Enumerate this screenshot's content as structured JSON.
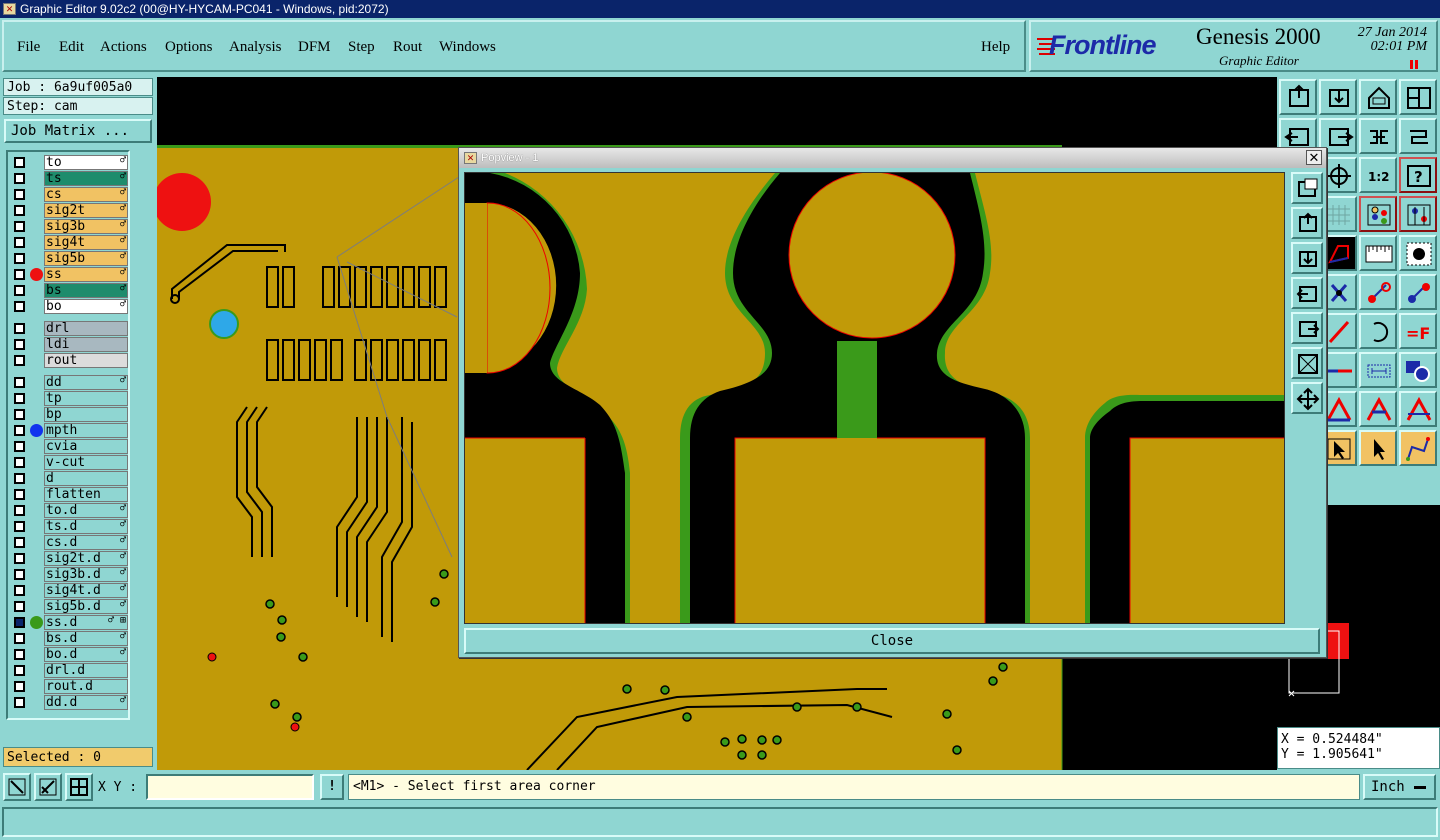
{
  "window": {
    "title": "Graphic Editor 9.02c2 (00@HY-HYCAM-PC041 - Windows, pid:2072)"
  },
  "menu": {
    "file": "File",
    "edit": "Edit",
    "actions": "Actions",
    "options": "Options",
    "analysis": "Analysis",
    "dfm": "DFM",
    "step": "Step",
    "rout": "Rout",
    "windows": "Windows",
    "help": "Help"
  },
  "brand": {
    "logo": "Frontline",
    "product": "Genesis 2000",
    "subtitle": "Graphic Editor",
    "date": "27 Jan 2014",
    "time": "02:01 PM"
  },
  "job": {
    "job_label": "Job : 6a9uf005a0",
    "step_label": "Step: cam",
    "matrix_button": "Job Matrix ..."
  },
  "layers": [
    {
      "name": "to",
      "color": "#ffffff",
      "mark": "♂"
    },
    {
      "name": "ts",
      "color": "#1e8c6c",
      "mark": "♂"
    },
    {
      "name": "cs",
      "color": "#f1c263",
      "mark": "♂"
    },
    {
      "name": "sig2t",
      "color": "#f1c263",
      "mark": "♂"
    },
    {
      "name": "sig3b",
      "color": "#f1c263",
      "mark": "♂"
    },
    {
      "name": "sig4t",
      "color": "#f1c263",
      "mark": "♂"
    },
    {
      "name": "sig5b",
      "color": "#f1c263",
      "mark": "♂"
    },
    {
      "name": "ss",
      "color": "#f1c263",
      "mark": "♂",
      "dot": "#ee1111"
    },
    {
      "name": "bs",
      "color": "#1e8c6c",
      "mark": "♂"
    },
    {
      "name": "bo",
      "color": "#ffffff",
      "mark": "♂"
    },
    {
      "name": "drl",
      "color": "#a8b8c0",
      "mark": ""
    },
    {
      "name": "ldi",
      "color": "#a8b8c0",
      "mark": ""
    },
    {
      "name": "rout",
      "color": "#dcdcdc",
      "mark": ""
    },
    {
      "name": "dd",
      "color": "#8fd6d2",
      "mark": "♂"
    },
    {
      "name": "tp",
      "color": "#8fd6d2",
      "mark": ""
    },
    {
      "name": "bp",
      "color": "#8fd6d2",
      "mark": ""
    },
    {
      "name": "mpth",
      "color": "#8fd6d2",
      "mark": "",
      "dot": "#1133ee"
    },
    {
      "name": "cvia",
      "color": "#8fd6d2",
      "mark": ""
    },
    {
      "name": "v-cut",
      "color": "#8fd6d2",
      "mark": ""
    },
    {
      "name": "d",
      "color": "#8fd6d2",
      "mark": ""
    },
    {
      "name": "flatten",
      "color": "#8fd6d2",
      "mark": ""
    },
    {
      "name": "to.d",
      "color": "#8fd6d2",
      "mark": "♂"
    },
    {
      "name": "ts.d",
      "color": "#8fd6d2",
      "mark": "♂"
    },
    {
      "name": "cs.d",
      "color": "#8fd6d2",
      "mark": "♂"
    },
    {
      "name": "sig2t.d",
      "color": "#8fd6d2",
      "mark": "♂"
    },
    {
      "name": "sig3b.d",
      "color": "#8fd6d2",
      "mark": "♂"
    },
    {
      "name": "sig4t.d",
      "color": "#8fd6d2",
      "mark": "♂"
    },
    {
      "name": "sig5b.d",
      "color": "#8fd6d2",
      "mark": "♂"
    },
    {
      "name": "ss.d",
      "color": "#8fd6d2",
      "mark": "♂ ⊞",
      "dot": "#3a9a1a",
      "work": true
    },
    {
      "name": "bs.d",
      "color": "#8fd6d2",
      "mark": "♂"
    },
    {
      "name": "bo.d",
      "color": "#8fd6d2",
      "mark": "♂"
    },
    {
      "name": "drl.d",
      "color": "#8fd6d2",
      "mark": ""
    },
    {
      "name": "rout.d",
      "color": "#8fd6d2",
      "mark": ""
    },
    {
      "name": "dd.d",
      "color": "#8fd6d2",
      "mark": "♂"
    }
  ],
  "selected": "Selected : 0",
  "popview": {
    "title": "Popview - 1",
    "close_button": "Close"
  },
  "coords": {
    "x": "X = 0.524484\"",
    "y": "Y = 1.905641\""
  },
  "bottom": {
    "xy_label": "X Y :",
    "xy_value": "",
    "warn": "!",
    "prompt": "<M1> - Select first area corner",
    "unit": "Inch"
  },
  "colors": {
    "panel": "#8fd6d2",
    "copper": "#c19a08",
    "mask": "#3a9a1a",
    "highlight": "#ee1111"
  }
}
